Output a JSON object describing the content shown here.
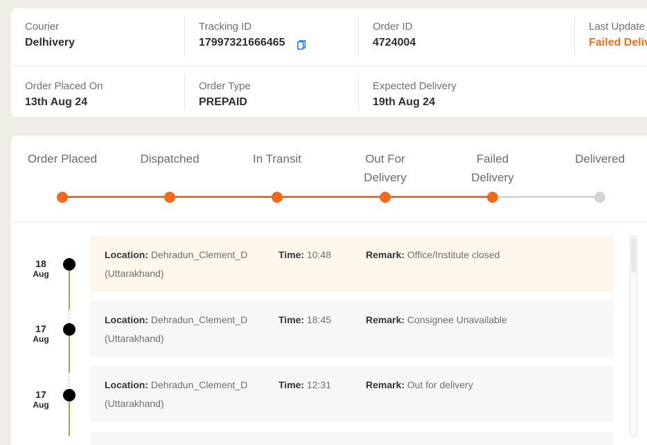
{
  "summary": {
    "courier": {
      "label": "Courier",
      "value": "Delhivery"
    },
    "tracking_id": {
      "label": "Tracking ID",
      "value": "17997321666465"
    },
    "order_id": {
      "label": "Order ID",
      "value": "4724004"
    },
    "last_update": {
      "label": "Last Update",
      "value": "Failed Deliv"
    },
    "order_placed_on": {
      "label": "Order Placed On",
      "value": "13th Aug 24"
    },
    "order_type": {
      "label": "Order Type",
      "value": "PREPAID"
    },
    "expected_delivery": {
      "label": "Expected Delivery",
      "value": "19th Aug 24"
    }
  },
  "progress": {
    "steps": [
      {
        "label": "Order Placed",
        "done": true
      },
      {
        "label": "Dispatched",
        "done": true
      },
      {
        "label": "In Transit",
        "done": true
      },
      {
        "label": "Out For Delivery",
        "done": true
      },
      {
        "label": "Failed Delivery",
        "done": true
      },
      {
        "label": "Delivered",
        "done": false
      }
    ]
  },
  "events": {
    "location_key": "Location:",
    "time_key": "Time:",
    "remark_key": "Remark:",
    "items": [
      {
        "day": "18",
        "month": "Aug",
        "location": "Dehradun_Clement_D (Uttarakhand)",
        "time": "10:48",
        "remark": "Office/Institute closed"
      },
      {
        "day": "17",
        "month": "Aug",
        "location": "Dehradun_Clement_D (Uttarakhand)",
        "time": "18:45",
        "remark": "Consignee Unavailable"
      },
      {
        "day": "17",
        "month": "Aug",
        "location": "Dehradun_Clement_D (Uttarakhand)",
        "time": "12:31",
        "remark": "Out for delivery"
      }
    ]
  },
  "colors": {
    "accent": "#f26b1d",
    "pending": "#d4d4d4",
    "timeline": "#8fb338",
    "copy_icon": "#1a73e8"
  },
  "icons": {
    "copy": "copy-icon"
  }
}
